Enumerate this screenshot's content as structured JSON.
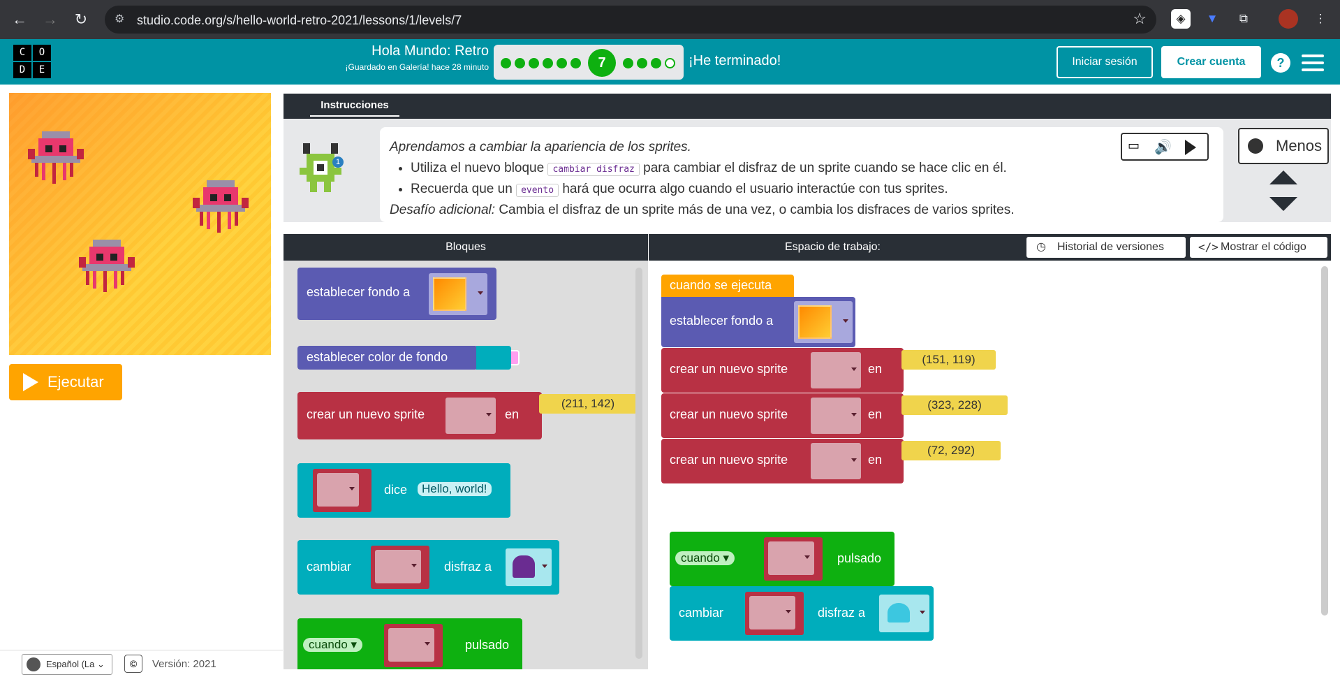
{
  "browser": {
    "url": "studio.code.org/s/hello-world-retro-2021/lessons/1/levels/7"
  },
  "header": {
    "logo_letters": [
      "C",
      "O",
      "D",
      "E"
    ],
    "title": "Hola Mundo: Retro",
    "saved": "¡Guardado en Galería! hace 28 minuto",
    "current_level": "7",
    "finished": "¡He terminado!",
    "login": "Iniciar sesión",
    "create": "Crear cuenta",
    "help": "?"
  },
  "left": {
    "run": "Ejecutar",
    "language": "Español (La",
    "copyright": "©",
    "version": "Versión: 2021"
  },
  "instructions": {
    "tab": "Instrucciones",
    "lead": "Aprendamos a cambiar la apariencia de los sprites.",
    "li1_a": "Utiliza el nuevo bloque",
    "li1_code": "cambiar disfraz",
    "li1_b": "para cambiar el disfraz de un sprite cuando se hace clic en él.",
    "li2_a": "Recuerda que un",
    "li2_code": "evento",
    "li2_b": "hará que ocurra algo cuando el usuario interactúe con tus sprites.",
    "extra_label": "Desafío adicional:",
    "extra_text": "Cambia el disfraz de un sprite más de una vez, o cambia los disfraces de varios sprites.",
    "less": "Menos",
    "badge": "1"
  },
  "panels": {
    "blocks": "Bloques",
    "workspace": "Espacio de trabajo:",
    "history": "Historial de versiones",
    "show_code": "Mostrar el código"
  },
  "toolbox": {
    "set_bg": "establecer fondo a",
    "set_bg_color": "establecer color de fondo",
    "new_sprite": "crear un nuevo sprite",
    "at": "en",
    "coord": "(211, 142)",
    "says": "dice",
    "hello": "Hello, world!",
    "change": "cambiar",
    "costume_to": "disfraz a",
    "when": "cuando",
    "clicked": "pulsado"
  },
  "workspace": {
    "when_run": "cuando se ejecuta",
    "set_bg": "establecer fondo a",
    "new_sprite": "crear un nuevo sprite",
    "at": "en",
    "coord1": "(151, 119)",
    "coord2": "(323, 228)",
    "coord3": "(72, 292)",
    "when": "cuando",
    "clicked": "pulsado",
    "change": "cambiar",
    "costume_to": "disfraz a"
  }
}
